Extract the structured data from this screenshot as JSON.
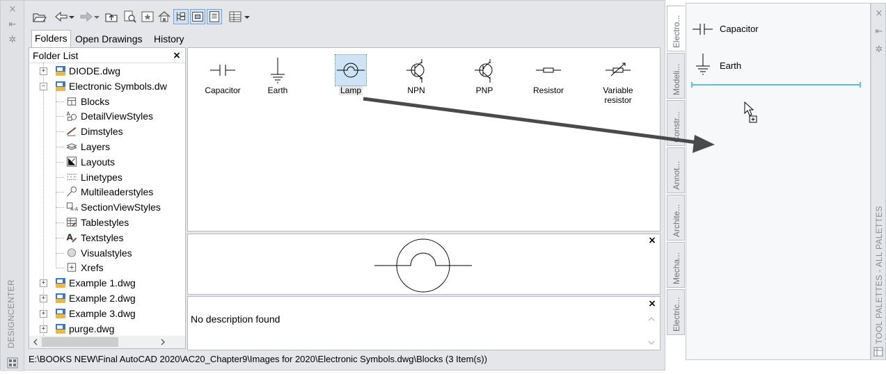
{
  "designcenter": {
    "close_glyph": "×",
    "pin_glyph": "⇤",
    "props_glyph": "✲",
    "vertical_title": "DESIGNCENTER",
    "tabs": [
      {
        "label": "Folders",
        "active": true
      },
      {
        "label": "Open Drawings",
        "active": false
      },
      {
        "label": "History",
        "active": false
      }
    ],
    "folder_list": {
      "header": "Folder List",
      "close_glyph": "×",
      "items": [
        {
          "label": "DIODE.dwg",
          "level": 0,
          "expander": "+"
        },
        {
          "label": "Electronic Symbols.dw",
          "level": 0,
          "expander": "−"
        },
        {
          "label": "Blocks",
          "level": 1,
          "icon": "blocks-icon"
        },
        {
          "label": "DetailViewStyles",
          "level": 1,
          "icon": "detail-view-styles-icon"
        },
        {
          "label": "Dimstyles",
          "level": 1,
          "icon": "dimstyles-icon"
        },
        {
          "label": "Layers",
          "level": 1,
          "icon": "layers-icon"
        },
        {
          "label": "Layouts",
          "level": 1,
          "icon": "layouts-icon"
        },
        {
          "label": "Linetypes",
          "level": 1,
          "icon": "linetypes-icon"
        },
        {
          "label": "Multileaderstyles",
          "level": 1,
          "icon": "multileader-styles-icon"
        },
        {
          "label": "SectionViewStyles",
          "level": 1,
          "icon": "section-view-styles-icon"
        },
        {
          "label": "Tablestyles",
          "level": 1,
          "icon": "tablestyles-icon"
        },
        {
          "label": "Textstyles",
          "level": 1,
          "icon": "textstyles-icon"
        },
        {
          "label": "Visualstyles",
          "level": 1,
          "icon": "visualstyles-icon"
        },
        {
          "label": "Xrefs",
          "level": 1,
          "icon": "xrefs-icon"
        },
        {
          "label": "Example 1.dwg",
          "level": 0,
          "expander": "+"
        },
        {
          "label": "Example 2.dwg",
          "level": 0,
          "expander": "+"
        },
        {
          "label": "Example 3.dwg",
          "level": 0,
          "expander": "+"
        },
        {
          "label": "purge.dwg",
          "level": 0,
          "expander": "+"
        }
      ]
    },
    "content_items": [
      {
        "label": "Capacitor",
        "symbol": "capacitor"
      },
      {
        "label": "Earth",
        "symbol": "earth"
      },
      {
        "label": "Lamp",
        "symbol": "lamp",
        "selected": true
      },
      {
        "label": "NPN",
        "symbol": "npn"
      },
      {
        "label": "PNP",
        "symbol": "pnp"
      },
      {
        "label": "Resistor",
        "symbol": "resistor"
      },
      {
        "label": "Variable resistor",
        "symbol": "variable-resistor"
      }
    ],
    "description": "No description found",
    "status_path": "E:\\BOOKS NEW\\Final AutoCAD 2020\\AC20_Chapter9\\Images for 2020\\Electronic Symbols.dwg\\Blocks (3 Item(s))"
  },
  "tool_palette": {
    "vertical_title": "TOOL PALETTES - ALL PALETTES",
    "close_glyph": "×",
    "pin_glyph": "⇤",
    "props_glyph": "✲",
    "tabs": [
      "Electro...",
      "Modeli...",
      "Constr...",
      "Annot...",
      "Archite...",
      "Mecha...",
      "Electric..."
    ],
    "items": [
      {
        "label": "Capacitor",
        "symbol": "capacitor"
      },
      {
        "label": "Earth",
        "symbol": "earth"
      }
    ]
  },
  "colors": {
    "drag_arrow": "#4a4a4a",
    "insert_line": "#5bc0e8",
    "selection": "#cfe3f6"
  }
}
